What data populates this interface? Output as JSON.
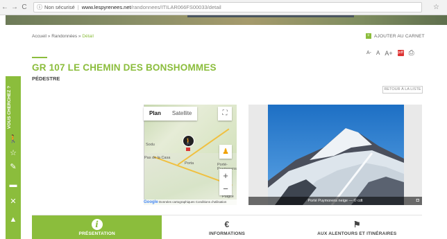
{
  "browser": {
    "back": "←",
    "forward": "→",
    "reload": "C",
    "security": "Non sécurisé",
    "url_domain": "www.lespyrenees.net",
    "url_path": "/randonnees/ITILAR066FS00033/detail",
    "star": "☆"
  },
  "side_tab": {
    "label": "VOUS CHERCHEZ ?"
  },
  "breadcrumb": {
    "home": "Accueil",
    "section": "Randonnées",
    "current": "Détail",
    "sep": " » "
  },
  "carnet": {
    "label": "AJOUTER AU CARNET"
  },
  "text_tools": {
    "smaller": "A-",
    "normal": "A",
    "larger": "A+",
    "pdf": "pdf",
    "print": "⎙"
  },
  "page": {
    "title": "GR 107 LE CHEMIN DES BONSHOMMES",
    "subtitle": "PÉDESTRE",
    "back_list": "RETOUR À LA LISTE"
  },
  "map": {
    "tab_plan": "Plan",
    "tab_satellite": "Satellite",
    "labels": [
      "Sodu",
      "Pas de la Casa",
      "Porta",
      "Porté-Puymorens",
      "Puigce"
    ],
    "footer_google": "Google",
    "footer_text": "Données cartographiques  Conditions d'utilisation"
  },
  "photo": {
    "caption": "Porté Puymorens neige — © cdt"
  },
  "tabs": [
    {
      "label": "PRÉSENTATION",
      "icon": "info-icon"
    },
    {
      "label": "INFORMATIONS",
      "icon": "piggy-bank-icon"
    },
    {
      "label": "AUX ALENTOURS ET ITINÉRAIRES",
      "icon": "flag-icon"
    }
  ],
  "colors": {
    "accent": "#8bbd3c"
  }
}
